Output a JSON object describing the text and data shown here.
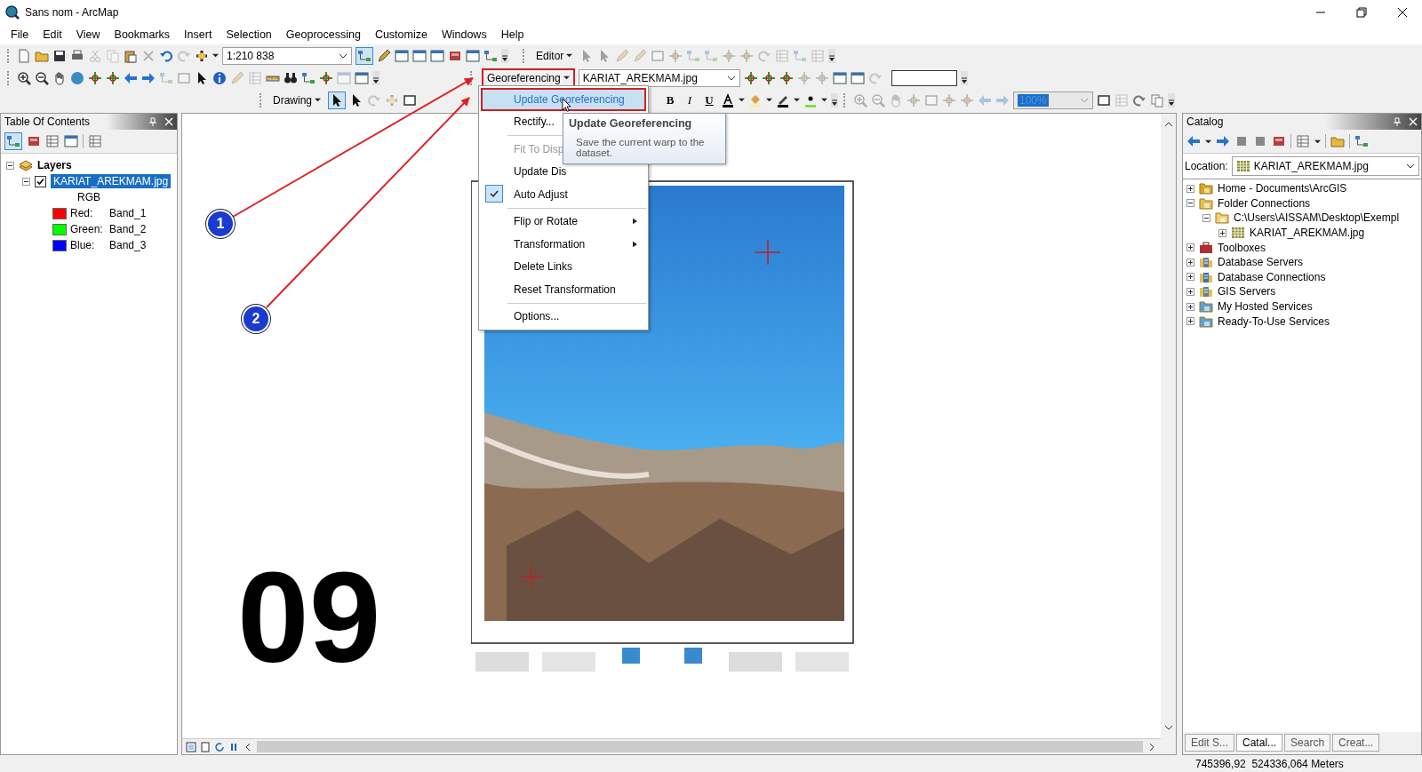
{
  "window": {
    "title": "Sans nom - ArcMap"
  },
  "menu_bar": [
    "File",
    "Edit",
    "View",
    "Bookmarks",
    "Insert",
    "Selection",
    "Geoprocessing",
    "Customize",
    "Windows",
    "Help"
  ],
  "toolbars": {
    "scale": "1:210 838",
    "editor": "Editor",
    "georeferencing": {
      "label": "Georeferencing",
      "outlined": true
    },
    "layer": "KARIAT_AREKMAM.jpg",
    "drawing": "Drawing",
    "format": [
      "B",
      "I",
      "U"
    ],
    "zoom": {
      "value": "100%",
      "disabled": true
    }
  },
  "table_of_contents": {
    "title": "Table Of Contents",
    "root": {
      "label": "Layers",
      "expanded": true
    },
    "layer": {
      "label": "KARIAT_AREKMAM.jpg",
      "checked": true,
      "selected": true,
      "expanded": true,
      "renderer": "RGB",
      "bands": [
        {
          "channel": "Red:",
          "band": "Band_1",
          "color": "#ff0000"
        },
        {
          "channel": "Green:",
          "band": "Band_2",
          "color": "#00ff00"
        },
        {
          "channel": "Blue:",
          "band": "Band_3",
          "color": "#0000ff"
        }
      ]
    }
  },
  "map": {
    "label": "09",
    "callouts": [
      {
        "number": "1"
      },
      {
        "number": "2"
      }
    ]
  },
  "georeferencing_menu": {
    "groups": [
      [
        {
          "label": "Update Georeferencing",
          "selected": true,
          "outlined": true,
          "disabled": false,
          "checked": false,
          "submenu": false
        },
        {
          "label": "Rectify...",
          "selected": false,
          "outlined": false,
          "disabled": false,
          "checked": false,
          "submenu": false
        }
      ],
      [
        {
          "label": "Fit To Disp",
          "selected": false,
          "outlined": false,
          "disabled": true,
          "checked": false,
          "submenu": false
        },
        {
          "label": "Update Dis",
          "selected": false,
          "outlined": false,
          "disabled": false,
          "checked": false,
          "submenu": false
        },
        {
          "label": "Auto Adjust",
          "selected": false,
          "outlined": false,
          "disabled": false,
          "checked": true,
          "submenu": false
        }
      ],
      [
        {
          "label": "Flip or Rotate",
          "selected": false,
          "outlined": false,
          "disabled": false,
          "checked": false,
          "submenu": true
        },
        {
          "label": "Transformation",
          "selected": false,
          "outlined": false,
          "disabled": false,
          "checked": false,
          "submenu": true
        },
        {
          "label": "Delete Links",
          "selected": false,
          "outlined": false,
          "disabled": false,
          "checked": false,
          "submenu": false
        },
        {
          "label": "Reset Transformation",
          "selected": false,
          "outlined": false,
          "disabled": false,
          "checked": false,
          "submenu": false
        }
      ],
      [
        {
          "label": "Options...",
          "selected": false,
          "outlined": false,
          "disabled": false,
          "checked": false,
          "submenu": false
        }
      ]
    ]
  },
  "tooltip": {
    "title": "Update Georeferencing",
    "text": "Save the current warp to the dataset."
  },
  "catalog": {
    "title": "Catalog",
    "location_label": "Location:",
    "location": "KARIAT_AREKMAM.jpg",
    "tree": [
      {
        "label": "Home - Documents\\ArcGIS",
        "kind": "home",
        "expanded": false
      },
      {
        "label": "Folder Connections",
        "kind": "connection",
        "expanded": true,
        "children": [
          {
            "label": "C:\\Users\\AISSAM\\Desktop\\Exempl",
            "kind": "folder",
            "expanded": true,
            "children": [
              {
                "label": "KARIAT_AREKMAM.jpg",
                "kind": "raster",
                "expanded": false
              }
            ]
          }
        ]
      },
      {
        "label": "Toolboxes",
        "kind": "toolbox",
        "expanded": false
      },
      {
        "label": "Database Servers",
        "kind": "server",
        "expanded": false
      },
      {
        "label": "Database Connections",
        "kind": "database",
        "expanded": false
      },
      {
        "label": "GIS Servers",
        "kind": "server",
        "expanded": false
      },
      {
        "label": "My Hosted Services",
        "kind": "cloud",
        "expanded": false
      },
      {
        "label": "Ready-To-Use Services",
        "kind": "cloud",
        "expanded": false
      }
    ]
  },
  "bottom_tabs": [
    {
      "label": "Edit S...",
      "selected": false
    },
    {
      "label": "Catal...",
      "selected": true
    },
    {
      "label": "Search",
      "selected": false
    },
    {
      "label": "Creat...",
      "selected": false
    }
  ],
  "status_bar": {
    "coordinates": "745396,92  524336,064 Meters"
  }
}
